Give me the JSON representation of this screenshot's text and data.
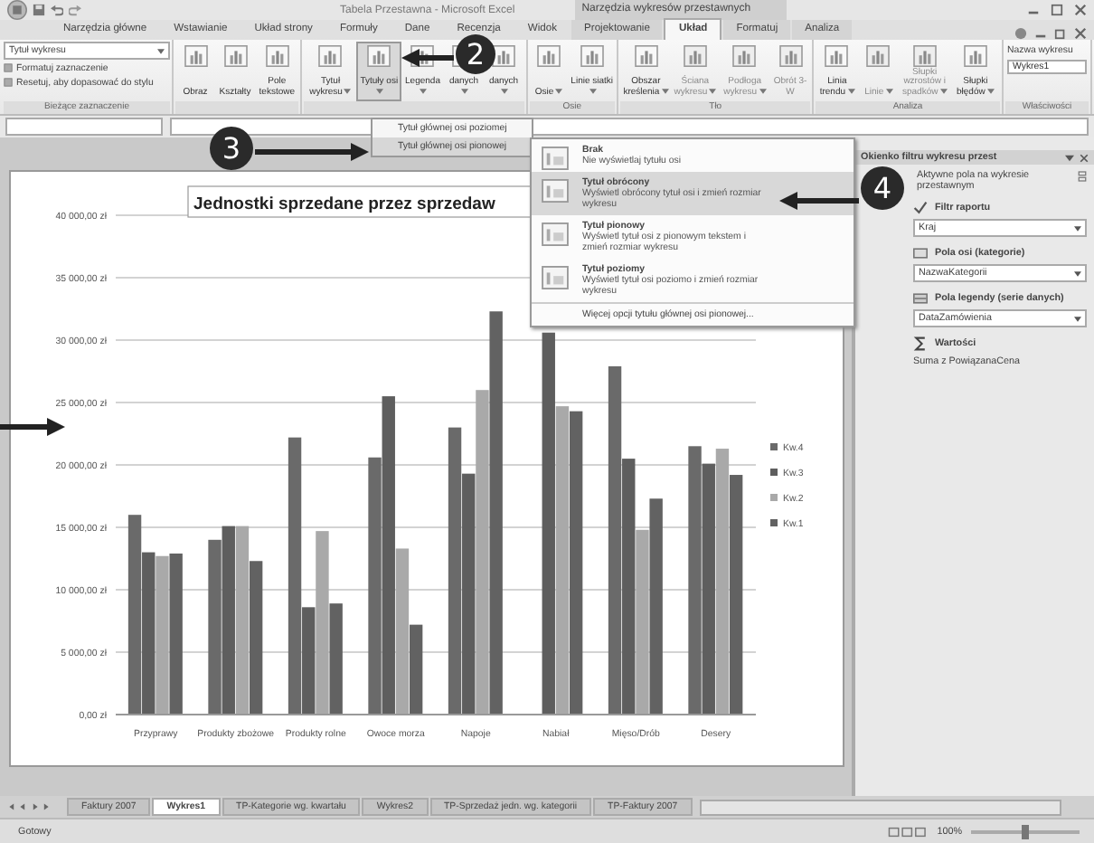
{
  "window": {
    "title": "Tabela Przestawna - Microsoft Excel",
    "context_title": "Narzędzia wykresów przestawnych"
  },
  "ribbon_tabs": [
    {
      "label": "Narzędzia główne",
      "selected": false
    },
    {
      "label": "Wstawianie",
      "selected": false
    },
    {
      "label": "Układ strony",
      "selected": false
    },
    {
      "label": "Formuły",
      "selected": false
    },
    {
      "label": "Dane",
      "selected": false
    },
    {
      "label": "Recenzja",
      "selected": false
    },
    {
      "label": "Widok",
      "selected": false
    },
    {
      "label": "Projektowanie",
      "selected": false
    },
    {
      "label": "Układ",
      "selected": true
    },
    {
      "label": "Formatuj",
      "selected": false
    },
    {
      "label": "Analiza",
      "selected": false
    }
  ],
  "ribbon_groups": [
    {
      "kind": "selection",
      "label": "Bieżące zaznaczenie",
      "combo": "Tytuł wykresu",
      "commands": [
        "Formatuj zaznaczenie",
        "Resetuj, aby dopasować do stylu"
      ]
    },
    {
      "kind": "buttons",
      "buttons": [
        {
          "label": "Obraz",
          "dropdown": false,
          "selected": false,
          "disabled": false
        },
        {
          "label": "Kształty",
          "dropdown": false,
          "selected": false,
          "disabled": false
        },
        {
          "label": "Pole tekstowe",
          "dropdown": false,
          "selected": false,
          "disabled": false
        }
      ]
    },
    {
      "kind": "buttons",
      "buttons": [
        {
          "label": "Tytuł wykresu",
          "dropdown": true,
          "selected": false,
          "disabled": false
        },
        {
          "label": "Tytuły osi",
          "dropdown": true,
          "selected": true,
          "disabled": false
        },
        {
          "label": "Legenda",
          "dropdown": true,
          "selected": false,
          "disabled": false
        },
        {
          "label": "danych",
          "dropdown": true,
          "selected": false,
          "disabled": false
        },
        {
          "label": "danych",
          "dropdown": true,
          "selected": false,
          "disabled": false
        }
      ]
    },
    {
      "kind": "buttons",
      "label": "Osie",
      "buttons": [
        {
          "label": "Osie",
          "dropdown": true,
          "selected": false,
          "disabled": false
        },
        {
          "label": "Linie siatki",
          "dropdown": true,
          "selected": false,
          "disabled": false
        }
      ]
    },
    {
      "kind": "buttons",
      "label": "Tło",
      "buttons": [
        {
          "label": "Obszar kreślenia",
          "dropdown": true,
          "selected": false,
          "disabled": false
        },
        {
          "label": "Ściana wykresu",
          "dropdown": true,
          "selected": false,
          "disabled": true
        },
        {
          "label": "Podłoga wykresu",
          "dropdown": true,
          "selected": false,
          "disabled": true
        },
        {
          "label": "Obrót 3-W",
          "dropdown": false,
          "selected": false,
          "disabled": true
        }
      ]
    },
    {
      "kind": "buttons",
      "label": "Analiza",
      "buttons": [
        {
          "label": "Linia trendu",
          "dropdown": true,
          "selected": false,
          "disabled": false
        },
        {
          "label": "Linie",
          "dropdown": true,
          "selected": false,
          "disabled": true
        },
        {
          "label": "Słupki wzrostów i spadków",
          "dropdown": true,
          "selected": false,
          "disabled": true
        },
        {
          "label": "Słupki błędów",
          "dropdown": true,
          "selected": false,
          "disabled": false
        }
      ]
    },
    {
      "kind": "properties",
      "label": "Właściwości",
      "field_label": "Nazwa wykresu",
      "field_value": "Wykres1"
    }
  ],
  "submenu": [
    {
      "label": "Tytuł głównej osi poziomej",
      "selected": false
    },
    {
      "label": "Tytuł głównej osi pionowej",
      "selected": true
    }
  ],
  "menu": {
    "options": [
      {
        "title": "Brak",
        "description": "Nie wyświetlaj tytułu osi",
        "selected": false
      },
      {
        "title": "Tytuł obrócony",
        "description": "Wyświetl obrócony tytuł osi i zmień rozmiar wykresu",
        "selected": true
      },
      {
        "title": "Tytuł pionowy",
        "description": "Wyświetl tytuł osi z pionowym tekstem i zmień rozmiar wykresu",
        "selected": false
      },
      {
        "title": "Tytuł poziomy",
        "description": "Wyświetl tytuł osi poziomo i zmień rozmiar wykresu",
        "selected": false
      }
    ],
    "footer": "Więcej opcji tytułu głównej osi pionowej..."
  },
  "chart": {
    "chart_data": {
      "type": "bar",
      "title": "Jednostki sprzedane przez sprzedaw",
      "grid": true,
      "legend": true,
      "categories": [
        "Przyprawy",
        "Produkty zbożowe",
        "Produkty rolne",
        "Owoce morza",
        "Napoje",
        "Nabiał",
        "Mięso/Drób",
        "Desery"
      ],
      "series": [
        {
          "name": "Kw.4",
          "color": "#6a6a6a",
          "values": [
            16000,
            14000,
            22200,
            20600,
            23000,
            null,
            27900,
            21500
          ]
        },
        {
          "name": "Kw.3",
          "color": "#5e5e5e",
          "values": [
            13000,
            15100,
            8600,
            25500,
            19300,
            30600,
            20500,
            20100
          ]
        },
        {
          "name": "Kw.2",
          "color": "#a9a9a9",
          "values": [
            12700,
            15100,
            14700,
            13300,
            26000,
            24700,
            14800,
            21300
          ]
        },
        {
          "name": "Kw.1",
          "color": "#626262",
          "values": [
            12900,
            12300,
            8900,
            7200,
            32300,
            24300,
            17300,
            19200
          ]
        }
      ],
      "ylim": [
        0,
        40000
      ],
      "yticks": [
        {
          "value": 0,
          "label": "0,00 zł"
        },
        {
          "value": 5000,
          "label": "5 000,00 zł"
        },
        {
          "value": 10000,
          "label": "10 000,00 zł"
        },
        {
          "value": 15000,
          "label": "15 000,00 zł"
        },
        {
          "value": 20000,
          "label": "20 000,00 zł"
        },
        {
          "value": 25000,
          "label": "25 000,00 zł"
        },
        {
          "value": 30000,
          "label": "30 000,00 zł"
        },
        {
          "value": 35000,
          "label": "35 000,00 zł"
        },
        {
          "value": 40000,
          "label": "40 000,00 zł"
        }
      ]
    }
  },
  "pane": {
    "title": "Okienko filtru wykresu przest",
    "subtitle": "Aktywne pola na wykresie przestawnym",
    "sections": [
      {
        "kind": "filter",
        "label": "Filtr raportu",
        "value": "Kraj"
      },
      {
        "kind": "axis",
        "label": "Pola osi (kategorie)",
        "value": "NazwaKategorii"
      },
      {
        "kind": "legend",
        "label": "Pola legendy (serie danych)",
        "value": "DataZamówienia"
      },
      {
        "kind": "values",
        "label": "Wartości",
        "value": "Suma z PowiązanaCena"
      }
    ]
  },
  "sheet_tabs": [
    {
      "label": "Faktury 2007",
      "selected": false
    },
    {
      "label": "Wykres1",
      "selected": true
    },
    {
      "label": "TP-Kategorie wg. kwartału",
      "selected": false
    },
    {
      "label": "Wykres2",
      "selected": false
    },
    {
      "label": "TP-Sprzedaż jedn. wg. kategorii",
      "selected": false
    },
    {
      "label": "TP-Faktury 2007",
      "selected": false
    }
  ],
  "status_bar": {
    "text": "Gotowy",
    "zoom": "100%",
    "zoom_slider": {
      "level": 0.5
    }
  },
  "callouts": [
    {
      "kind": "number",
      "label": "2"
    },
    {
      "kind": "number",
      "label": "3"
    },
    {
      "kind": "number",
      "label": "4"
    },
    {
      "kind": "arrow"
    }
  ]
}
